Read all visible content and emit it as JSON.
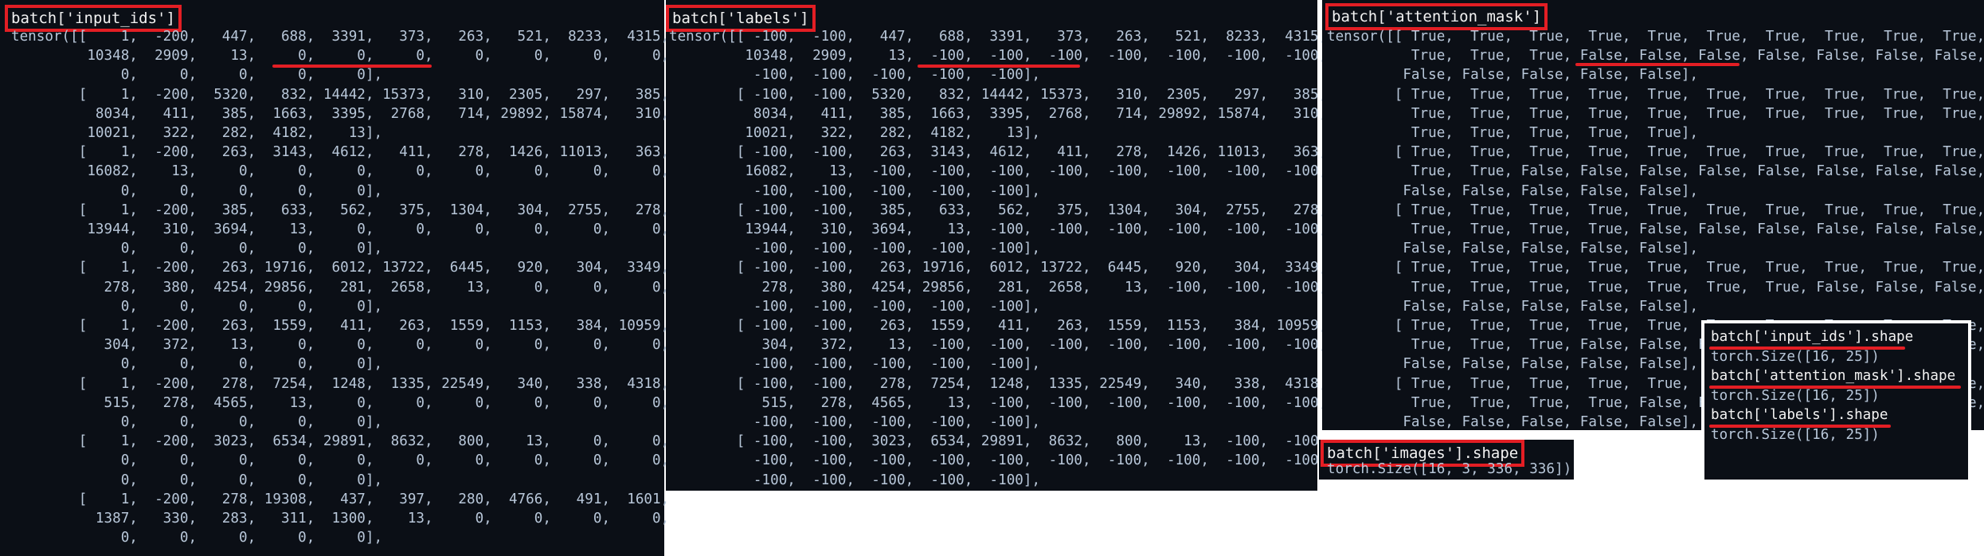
{
  "panels": {
    "input_ids": {
      "label": "batch['input_ids']",
      "output": "tensor([[    1,  -200,   447,   688,  3391,   373,   263,   521,  8233,  4315,\n         10348,  2909,    13,     0,     0,     0,     0,     0,     0,     0,\n             0,     0,     0,     0,     0],\n        [    1,  -200,  5320,   832, 14442, 15373,   310,  2305,   297,   385,\n          8034,   411,   385,  1663,  3395,  2768,   714, 29892, 15874,   310,\n         10021,   322,   282,  4182,    13],\n        [    1,  -200,   263,  3143,  4612,   411,   278,  1426, 11013,   363,\n         16082,    13,     0,     0,     0,     0,     0,     0,     0,     0,\n             0,     0,     0,     0,     0],\n        [    1,  -200,   385,   633,   562,   375,  1304,   304,  2755,   278,\n         13944,   310,  3694,    13,     0,     0,     0,     0,     0,     0,\n             0,     0,     0,     0,     0],\n        [    1,  -200,   263, 19716,  6012, 13722,  6445,   920,   304,  3349,\n           278,   380,  4254, 29856,   281,  2658,    13,     0,     0,     0,\n             0,     0,     0,     0,     0],\n        [    1,  -200,   263,  1559,   411,   263,  1559,  1153,   384, 10959,\n           304,   372,    13,     0,     0,     0,     0,     0,     0,     0,\n             0,     0,     0,     0,     0],\n        [    1,  -200,   278,  7254,  1248,  1335, 22549,   340,   338,  4318,\n           515,   278,  4565,    13,     0,     0,     0,     0,     0,     0,\n             0,     0,     0,     0,     0],\n        [    1,  -200,  3023,  6534, 29891,  8632,   800,    13,     0,     0,\n             0,     0,     0,     0,     0,     0,     0,     0,     0,     0,\n             0,     0,     0,     0,     0],\n        [    1,  -200,   278, 19308,   437,   397,   280,  4766,   491,  1601,\n          1387,   330,   283,   311,  1300,    13,     0,     0,     0,     0,\n             0,     0,     0,     0,     0],"
    },
    "labels": {
      "label": "batch['labels']",
      "output": "tensor([[ -100,  -100,   447,   688,  3391,   373,   263,   521,  8233,  4315,\n         10348,  2909,    13,  -100,  -100,  -100,  -100,  -100,  -100,  -100,\n          -100,  -100,  -100,  -100,  -100],\n        [ -100,  -100,  5320,   832, 14442, 15373,   310,  2305,   297,   385,\n          8034,   411,   385,  1663,  3395,  2768,   714, 29892, 15874,   310,\n         10021,   322,   282,  4182,    13],\n        [ -100,  -100,   263,  3143,  4612,   411,   278,  1426, 11013,   363,\n         16082,    13,  -100,  -100,  -100,  -100,  -100,  -100,  -100,  -100,\n          -100,  -100,  -100,  -100,  -100],\n        [ -100,  -100,   385,   633,   562,   375,  1304,   304,  2755,   278,\n         13944,   310,  3694,    13,  -100,  -100,  -100,  -100,  -100,  -100,\n          -100,  -100,  -100,  -100,  -100],\n        [ -100,  -100,   263, 19716,  6012, 13722,  6445,   920,   304,  3349,\n           278,   380,  4254, 29856,   281,  2658,    13,  -100,  -100,  -100,\n          -100,  -100,  -100,  -100,  -100],\n        [ -100,  -100,   263,  1559,   411,   263,  1559,  1153,   384, 10959,\n           304,   372,    13,  -100,  -100,  -100,  -100,  -100,  -100,  -100,\n          -100,  -100,  -100,  -100,  -100],\n        [ -100,  -100,   278,  7254,  1248,  1335, 22549,   340,   338,  4318,\n           515,   278,  4565,    13,  -100,  -100,  -100,  -100,  -100,  -100,\n          -100,  -100,  -100,  -100,  -100],\n        [ -100,  -100,  3023,  6534, 29891,  8632,   800,    13,  -100,  -100,\n          -100,  -100,  -100,  -100,  -100,  -100,  -100,  -100,  -100,  -100,\n          -100,  -100,  -100,  -100,  -100],"
    },
    "attention_mask": {
      "label": "batch['attention_mask']",
      "output": "tensor([[ True,  True,  True,  True,  True,  True,  True,  True,  True,  True,\n          True,  True,  True, False, False, False, False, False, False, False,\n         False, False, False, False, False],\n        [ True,  True,  True,  True,  True,  True,  True,  True,  True,  True,\n          True,  True,  True,  True,  True,  True,  True,  True,  True,  True,\n          True,  True,  True,  True,  True],\n        [ True,  True,  True,  True,  True,  True,  True,  True,  True,  True,\n          True,  True, False, False, False, False, False, False, False, False,\n         False, False, False, False, False],\n        [ True,  True,  True,  True,  True,  True,  True,  True,  True,  True,\n          True,  True,  True,  True, False, False, False, False, False, False,\n         False, False, False, False, False],\n        [ True,  True,  True,  True,  True,  True,  True,  True,  True,  True,\n          True,  True,  True,  True,  True,  True,  True, False, False, False,\n         False, False, False, False, False],\n        [ True,  True,  True,  True,  True,  True,  True,  True,  True,  True,\n          True,  True,  True, False, False, False, False, False, False, False,\n         False, False, False, False, False],\n        [ True,  True,  True,  True,  True,  True,  True,  True,  True,  True,\n          True,  True,  True,  True, False, False, False, False, False, False,\n         False, False, False, False, False],"
    },
    "images": {
      "label": "batch['images'].shape",
      "output": "torch.Size([16, 3, 336, 336])"
    }
  },
  "shapes": {
    "input_ids_cmd": "batch['input_ids'].shape",
    "input_ids_res": "torch.Size([16, 25])",
    "attention_mask_cmd": "batch['attention_mask'].shape",
    "attention_mask_res": "torch.Size([16, 25])",
    "labels_cmd": "batch['labels'].shape",
    "labels_res": "torch.Size([16, 25])"
  },
  "colors": {
    "background": "#0b0f16",
    "text": "#b8c7d9",
    "highlight": "#e31e24"
  }
}
